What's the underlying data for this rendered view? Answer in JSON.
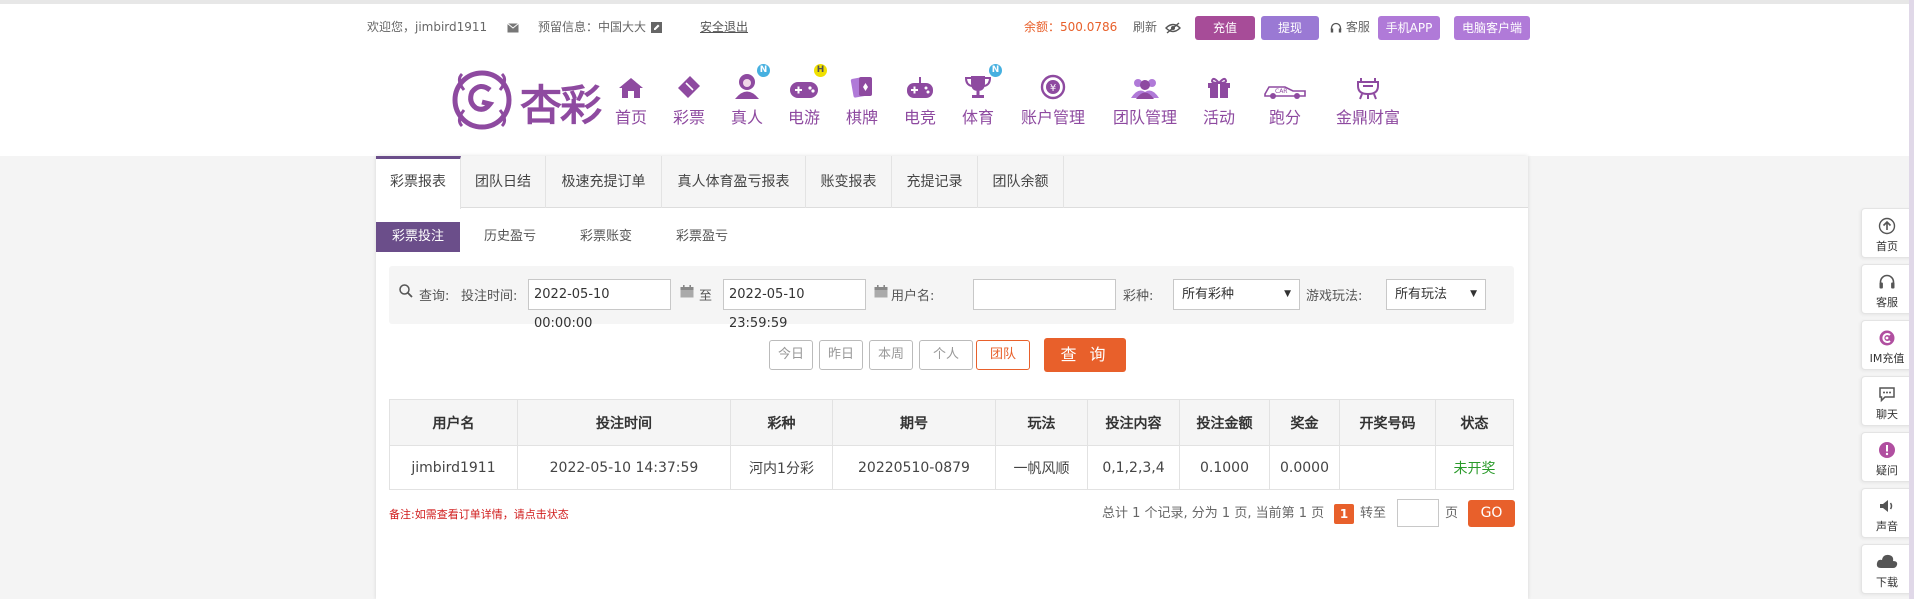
{
  "topbar": {
    "welcome": "欢迎您，jimbird1911",
    "mail_icon": "mail-icon",
    "notice": "预留信息：中国大大",
    "edit_icon": "edit-icon",
    "logout": "安全退出",
    "balance_label": "余额：",
    "balance_value": "500.0786",
    "refresh": "刷新",
    "eye_icon": "eye-off-icon",
    "recharge": "充值",
    "withdraw": "提现",
    "service": "客服",
    "mobile_app": "手机APP",
    "pc_client": "电脑客户端",
    "colors": {
      "recharge": "#a74c98",
      "withdraw": "#9a79d4",
      "mobile": "#b07ad8",
      "pc": "#b07ad8",
      "accent": "#e8602b"
    }
  },
  "header": {
    "logo_text": "杏彩",
    "nav": [
      {
        "label": "首页",
        "icon": "home-icon",
        "badge": ""
      },
      {
        "label": "彩票",
        "icon": "ticket-icon",
        "badge": ""
      },
      {
        "label": "真人",
        "icon": "dealer-icon",
        "badge": "N"
      },
      {
        "label": "电游",
        "icon": "gamepad-icon",
        "badge": "H"
      },
      {
        "label": "棋牌",
        "icon": "cards-icon",
        "badge": ""
      },
      {
        "label": "电竞",
        "icon": "joystick-icon",
        "badge": ""
      },
      {
        "label": "体育",
        "icon": "trophy-icon",
        "badge": "N"
      },
      {
        "label": "账户管理",
        "icon": "account-icon",
        "badge": ""
      },
      {
        "label": "团队管理",
        "icon": "team-icon",
        "badge": ""
      },
      {
        "label": "活动",
        "icon": "gift-icon",
        "badge": ""
      },
      {
        "label": "跑分",
        "icon": "car-icon",
        "badge": ""
      },
      {
        "label": "金鼎财富",
        "icon": "ding-icon",
        "badge": ""
      }
    ]
  },
  "tabs": [
    "彩票报表",
    "团队日结",
    "极速充提订单",
    "真人体育盈亏报表",
    "账变报表",
    "充提记录",
    "团队余额"
  ],
  "subtabs": [
    "彩票投注",
    "历史盈亏",
    "彩票账变",
    "彩票盈亏"
  ],
  "filter": {
    "query_label": "查询:",
    "time_label": "投注时间:",
    "start_time": "2022-05-10 00:00:00",
    "to_label": "至",
    "end_time": "2022-05-10 23:59:59",
    "user_label": "用户名:",
    "user_value": "",
    "lottery_label": "彩种:",
    "lottery_value": "所有彩种",
    "play_label": "游戏玩法:",
    "play_value": "所有玩法"
  },
  "quick": [
    "今日",
    "昨日",
    "本周",
    "个人",
    "团队"
  ],
  "search_button": "查 询",
  "table": {
    "headers": [
      "用户名",
      "投注时间",
      "彩种",
      "期号",
      "玩法",
      "投注内容",
      "投注金额",
      "奖金",
      "开奖号码",
      "状态"
    ],
    "rows": [
      [
        "jimbird1911",
        "2022-05-10 14:37:59",
        "河内1分彩",
        "20220510-0879",
        "一帆风顺",
        "0,1,2,3,4",
        "0.1000",
        "0.0000",
        "",
        "未开奖"
      ]
    ]
  },
  "note": "备注:如需查看订单详情，请点击状态",
  "pager": {
    "summary": "总计 1 个记录, 分为 1 页, 当前第 1 页",
    "current": "1",
    "goto_label": "转至",
    "page_label": "页",
    "go": "GO"
  },
  "sidebar": [
    {
      "label": "首页",
      "icon": "arrow-up-icon"
    },
    {
      "label": "客服",
      "icon": "headset-icon"
    },
    {
      "label": "IM充值",
      "icon": "im-recharge-icon"
    },
    {
      "label": "聊天",
      "icon": "chat-icon"
    },
    {
      "label": "疑问",
      "icon": "alert-icon"
    },
    {
      "label": "声音",
      "icon": "speaker-icon"
    },
    {
      "label": "下载",
      "icon": "cloud-download-icon"
    }
  ]
}
